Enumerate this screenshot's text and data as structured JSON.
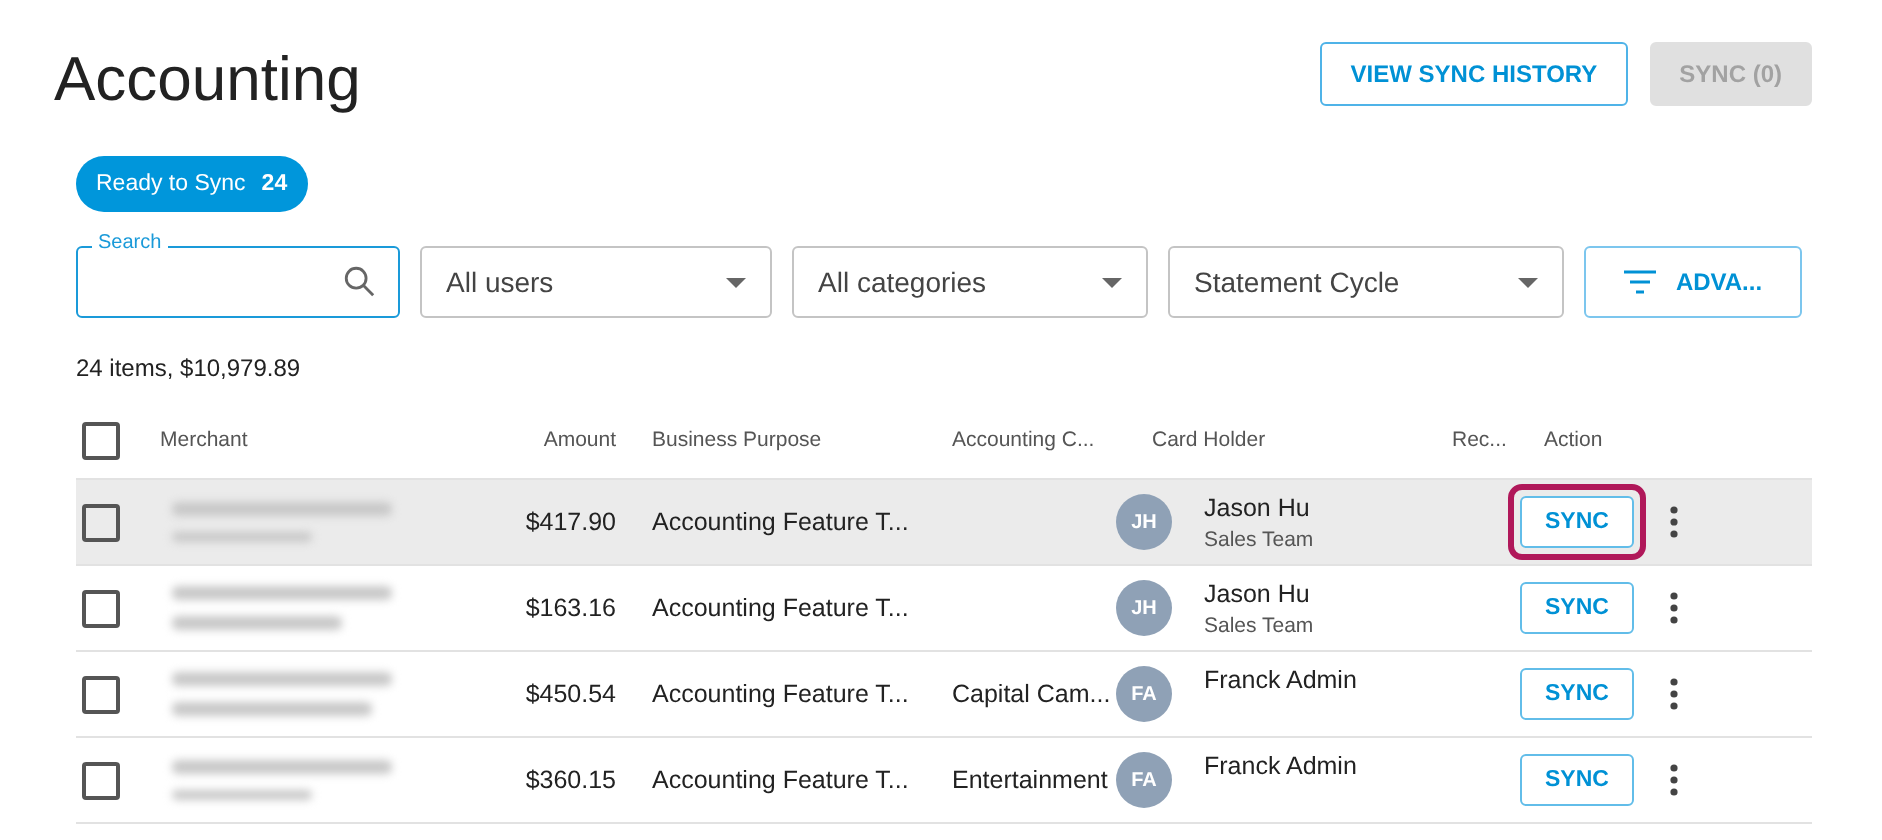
{
  "page": {
    "title": "Accounting"
  },
  "header_buttons": [
    {
      "label": "VIEW SYNC HISTORY",
      "disabled": false
    },
    {
      "label": "SYNC (0)",
      "disabled": true
    }
  ],
  "status_chip": {
    "label": "Ready to Sync",
    "count": "24"
  },
  "filters": {
    "search": {
      "label": "Search"
    },
    "dropdowns": [
      "All users",
      "All categories",
      "Statement Cycle"
    ],
    "advanced": "ADVA..."
  },
  "summary": "24 items, $10,979.89",
  "table": {
    "select_all_checked": false,
    "columns": [
      "Merchant",
      "Amount",
      "Business Purpose",
      "Accounting C...",
      "Card Holder",
      "Rec...",
      "Action"
    ],
    "rows": [
      {
        "checked": false,
        "highlighted": true,
        "amount": "$417.90",
        "purpose": "Accounting Feature T...",
        "category": "",
        "initials": "JH",
        "holder": "Jason Hu",
        "team": "Sales Team",
        "action": "SYNC",
        "callout": true
      },
      {
        "checked": false,
        "highlighted": false,
        "amount": "$163.16",
        "purpose": "Accounting Feature T...",
        "category": "",
        "initials": "JH",
        "holder": "Jason Hu",
        "team": "Sales Team",
        "action": "SYNC",
        "callout": false
      },
      {
        "checked": false,
        "highlighted": false,
        "amount": "$450.54",
        "purpose": "Accounting Feature T...",
        "category": "Capital Cam...",
        "initials": "FA",
        "holder": "Franck Admin",
        "team": "",
        "action": "SYNC",
        "callout": false
      },
      {
        "checked": false,
        "highlighted": false,
        "amount": "$360.15",
        "purpose": "Accounting Feature T...",
        "category": "Entertainment",
        "initials": "FA",
        "holder": "Franck Admin",
        "team": "",
        "action": "SYNC",
        "callout": false
      }
    ]
  }
}
